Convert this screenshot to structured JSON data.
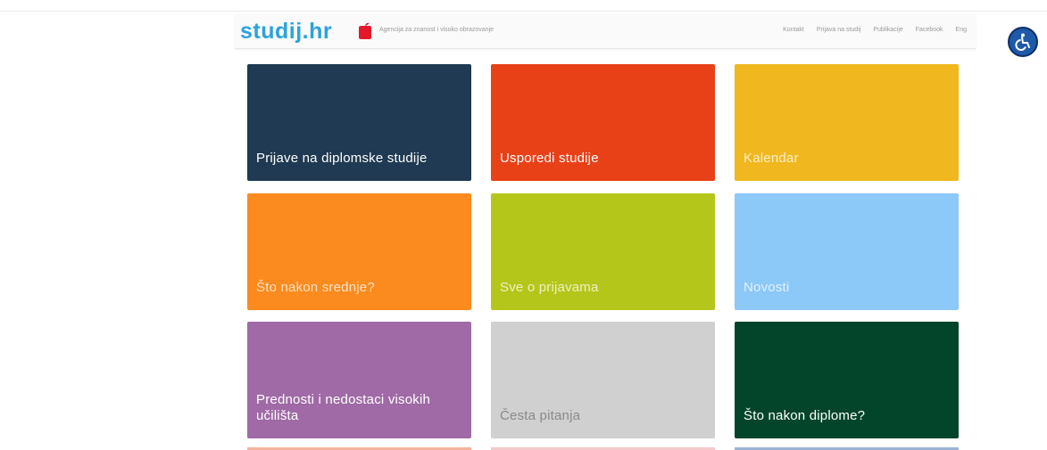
{
  "header": {
    "logo_text": "studij.hr",
    "tagline": "Agencija za znanost i visoko obrazovanje",
    "nav": [
      "Kontakt",
      "Prijava na studij",
      "Publikacije",
      "Facebook",
      "Eng"
    ]
  },
  "tiles": [
    {
      "label": "Prijave na diplomske studije",
      "color": "#1f3a52"
    },
    {
      "label": "Usporedi studije",
      "color": "#e84118"
    },
    {
      "label": "Kalendar",
      "color": "#f0b81e"
    },
    {
      "label": "Što nakon srednje?",
      "color": "#fb8b1e"
    },
    {
      "label": "Sve o prijavama",
      "color": "#b5c61a"
    },
    {
      "label": "Novosti",
      "color": "#8cc8f8"
    },
    {
      "label": "Prednosti i nedostaci visokih učilišta",
      "color": "#a06aa6"
    },
    {
      "label": "Česta pitanja",
      "color": "#d0d0d0"
    },
    {
      "label": "Što nakon diplome?",
      "color": "#03452b"
    }
  ],
  "colors": {
    "brand_blue": "#2ba3dc",
    "logo_apple": "#e4182a",
    "accessibility_blue": "#1e5aa8"
  },
  "icons": {
    "accessibility": "wheelchair-icon",
    "logo_mark": "apple-icon"
  }
}
